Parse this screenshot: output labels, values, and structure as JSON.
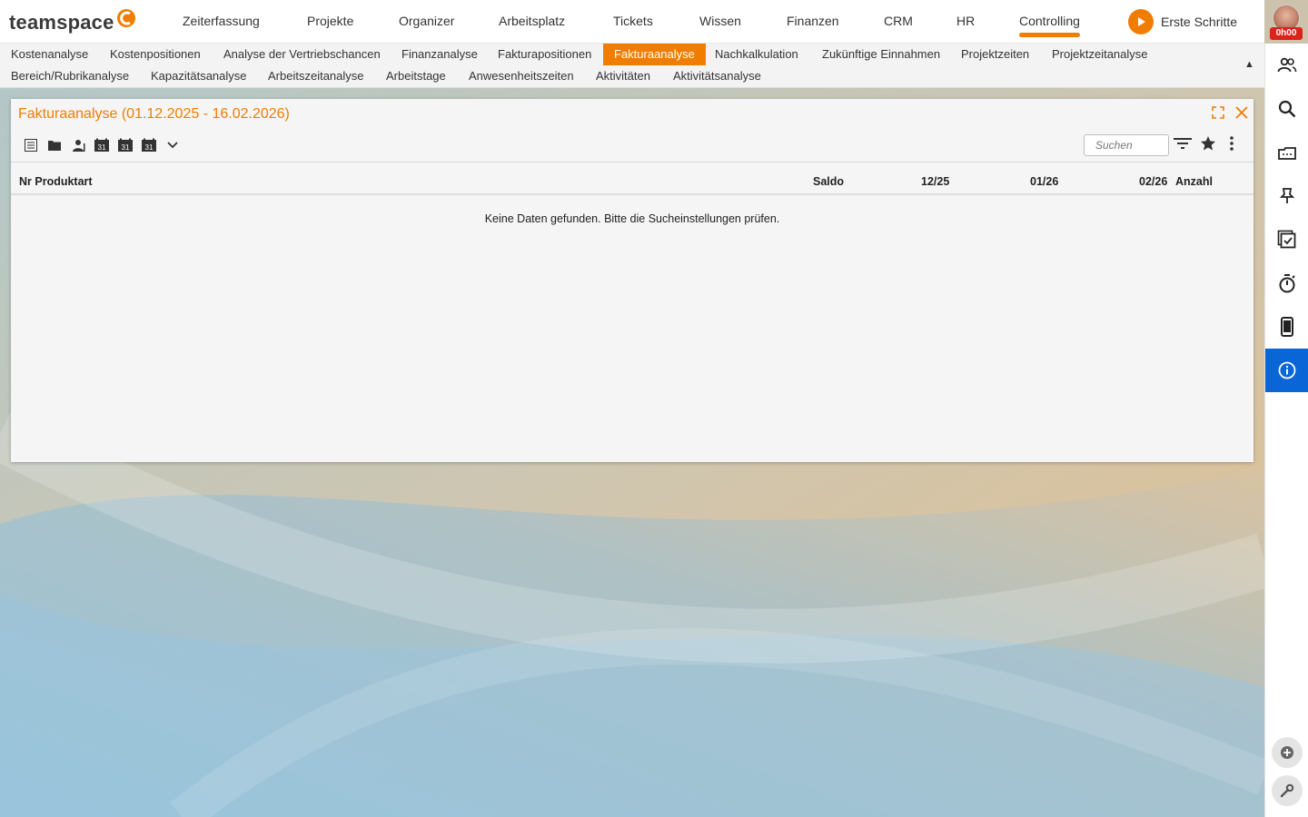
{
  "app": {
    "logo_text": "teamspace"
  },
  "topnav": {
    "items": [
      "Zeiterfassung",
      "Projekte",
      "Organizer",
      "Arbeitsplatz",
      "Tickets",
      "Wissen",
      "Finanzen",
      "CRM",
      "HR",
      "Controlling"
    ],
    "active": "Controlling",
    "erste_schritte": "Erste Schritte",
    "time_badge": "0h00"
  },
  "subnav": {
    "row1": [
      "Kostenanalyse",
      "Kostenpositionen",
      "Analyse der Vertriebschancen",
      "Finanzanalyse",
      "Fakturapositionen",
      "Fakturaanalyse",
      "Nachkalkulation",
      "Zukünftige Einnahmen",
      "Projektzeiten",
      "Projektzeitanalyse"
    ],
    "row2": [
      "Bereich/Rubrikanalyse",
      "Kapazitätsanalyse",
      "Arbeitszeitanalyse",
      "Arbeitstage",
      "Anwesenheitszeiten",
      "Aktivitäten",
      "Aktivitätsanalyse"
    ],
    "active": "Fakturaanalyse",
    "collapse_glyph": "▲"
  },
  "panel": {
    "title": "Fakturaanalyse (01.12.2025 - 16.02.2026)",
    "search_placeholder": "Suchen",
    "calendar_day": "31",
    "columns": {
      "nr_produktart": "Nr Produktart",
      "saldo": "Saldo",
      "m1": "12/25",
      "m2": "01/26",
      "m3": "02/26",
      "anzahl": "Anzahl"
    },
    "empty_message": "Keine Daten gefunden. Bitte die Sucheinstellungen prüfen."
  },
  "colors": {
    "accent": "#f07d00",
    "info_blue": "#0a66d6",
    "badge_red": "#d9241b"
  },
  "rightbar_icons": [
    "contacts-icon",
    "search-icon",
    "inbox-icon",
    "pin-icon",
    "tasks-icon",
    "stopwatch-icon",
    "mobile-icon",
    "info-icon",
    "add-circle-icon",
    "wrench-icon"
  ]
}
